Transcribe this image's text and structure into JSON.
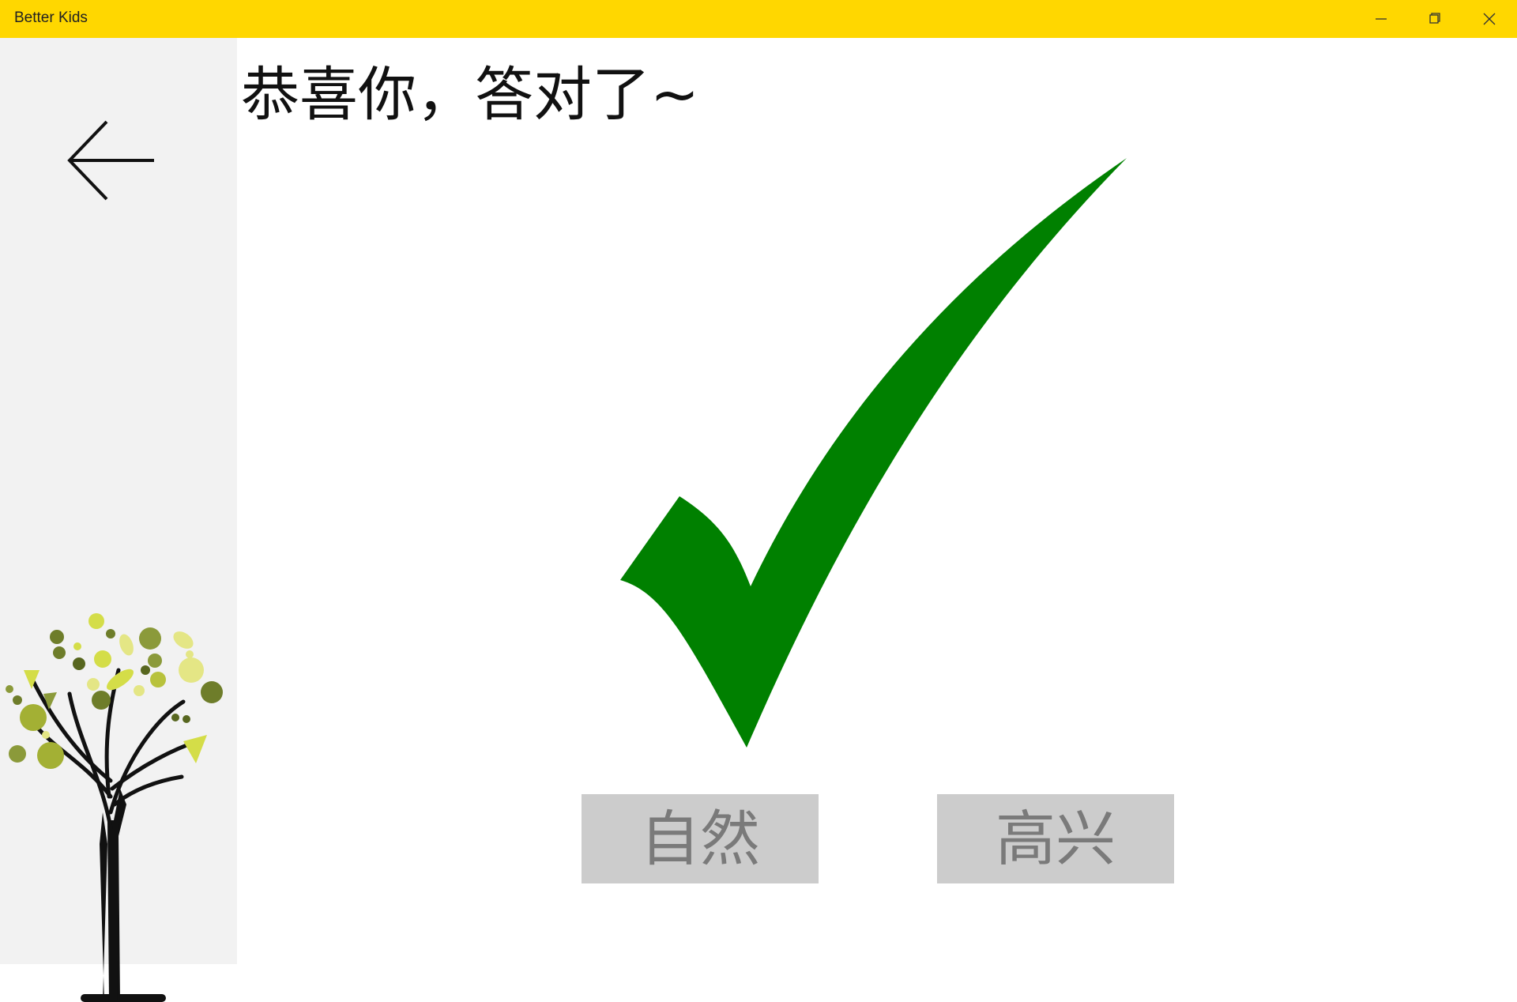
{
  "window": {
    "title": "Better Kids",
    "minimize_icon": "minimize-icon",
    "restore_icon": "restore-icon",
    "close_icon": "close-icon",
    "accent_color": "#FFD700"
  },
  "sidebar": {
    "back_icon": "arrow-left-icon",
    "illustration": "fruit-tree-illustration"
  },
  "main": {
    "heading": "恭喜你，答对了~",
    "result_icon": "checkmark-icon",
    "result_color": "#008000",
    "options": [
      {
        "label": "自然"
      },
      {
        "label": "高兴"
      }
    ]
  }
}
